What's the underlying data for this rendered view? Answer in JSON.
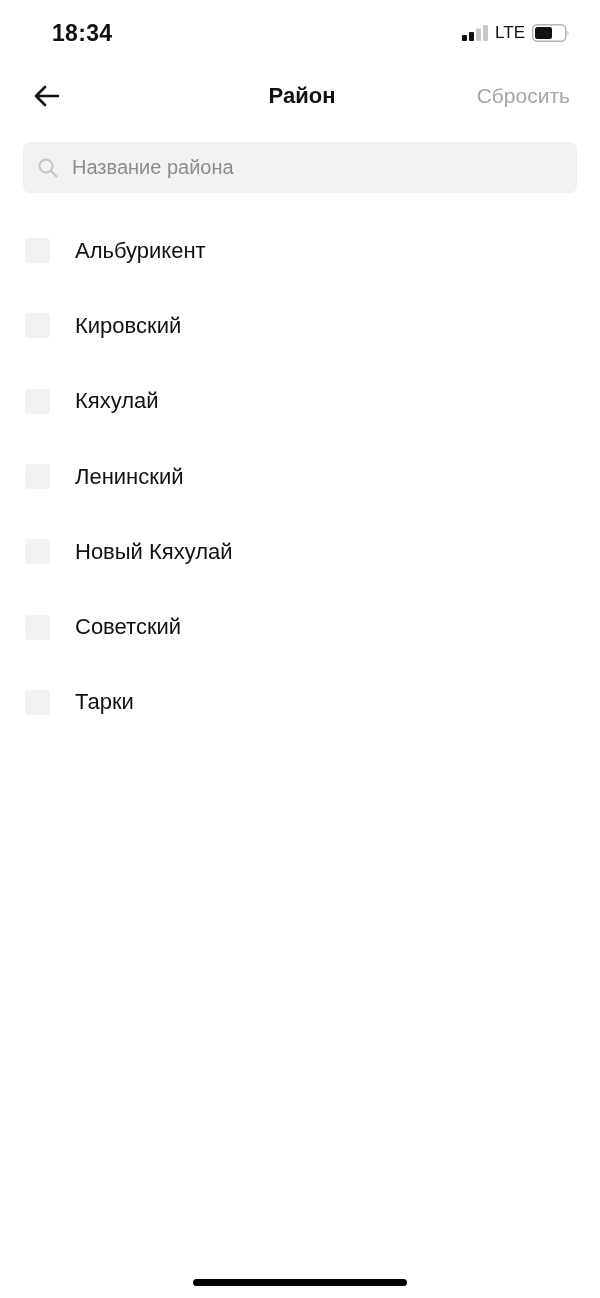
{
  "status_bar": {
    "time": "18:34",
    "network": "LTE"
  },
  "nav": {
    "title": "Район",
    "reset_button": {
      "label": "Сбросить",
      "disabled": true
    }
  },
  "search": {
    "placeholder": "Название района"
  },
  "districts": [
    {
      "name": "Альбурикент",
      "checked": false
    },
    {
      "name": "Кировский",
      "checked": false
    },
    {
      "name": "Кяхулай",
      "checked": false
    },
    {
      "name": "Ленинский",
      "checked": false
    },
    {
      "name": "Новый Кяхулай",
      "checked": false
    },
    {
      "name": "Советский",
      "checked": false
    },
    {
      "name": "Тарки",
      "checked": false
    }
  ]
}
